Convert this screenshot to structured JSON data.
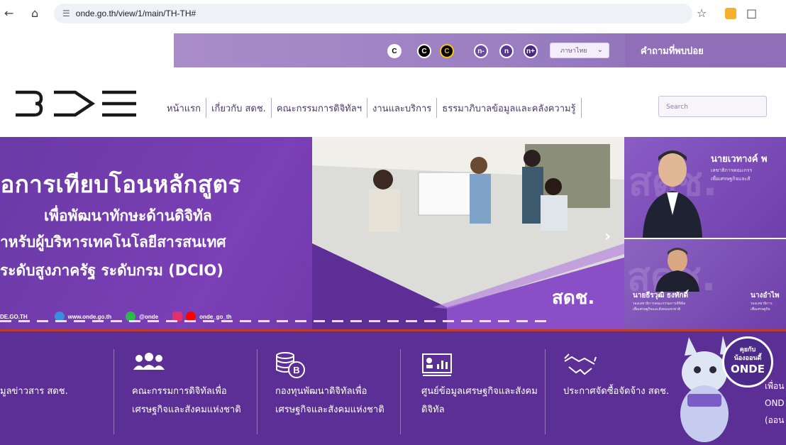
{
  "browser": {
    "url": "onde.go.th/view/1/main/TH-TH#",
    "icons": [
      "back-icon",
      "home-icon",
      "site-info-icon",
      "bookmark-star-icon",
      "extension-icon",
      "extensions-puzzle-icon"
    ]
  },
  "topbar": {
    "font_size_buttons": [
      "C",
      "C",
      "C"
    ],
    "contrast_buttons": [
      "n-",
      "n",
      "n+"
    ],
    "language_selected": "ภาษาไทย",
    "faq_label": "คำถามที่พบบ่อย"
  },
  "nav": {
    "items": [
      "หน้าแรก",
      "เกี่ยวกับ สดช.",
      "คณะกรรมการดิจิทัลฯ",
      "งานและบริการ",
      "ธรรมาภิบาลข้อมูลและคลังความรู้"
    ],
    "search_placeholder": "Search"
  },
  "hero": {
    "line1": "ื่อการเทียบโอนหลักสูตร",
    "line2": "เพื่อพัฒนาทักษะด้านดิจิทัล",
    "line3": "าหรับผู้บริหารเทคโนโลยีสารสนเทศ",
    "line4": "ระดับสูงภาครัฐ ระดับกรม (DCIO)",
    "footer": {
      "domain_partial": "DE.GO.TH",
      "website": "www.onde.go.th",
      "line_id": "@onde",
      "social": "onde_go_th"
    },
    "brand": "สดช.",
    "next_arrow": "›"
  },
  "executives": {
    "top": {
      "name": "นายเวทางค์ พ",
      "role_line1": "เลขาธิการคณะกรร",
      "role_line2": "เพื่อเศรษฐกิจและสั"
    },
    "bottom_left": {
      "name": "นายธีรวุฒิ ธงทักดิ์",
      "role_line1": "รองเลขาธิการคณะกรรมการดิจิทัล",
      "role_line2": "เพื่อเศรษฐกิจและสังคมแห่งชาติ"
    },
    "bottom_right": {
      "name": "นางอำไพ",
      "role_line1": "รองเลขาธิการ",
      "role_line2": "เพื่อเศรษฐกิจ"
    },
    "watermark": "สดช."
  },
  "services": [
    {
      "label": "มูลข่าวสาร สดช.",
      "icon": "info-icon"
    },
    {
      "label": "คณะกรรมการดิจิทัลเพื่อเศรษฐกิจและสังคมแห่งชาติ",
      "icon": "people-group-icon"
    },
    {
      "label": "กองทุนพัฒนาดิจิทัลเพื่อเศรษฐกิจและสังคมแห่งชาติ",
      "icon": "coins-fund-icon"
    },
    {
      "label": "ศูนย์ข้อมูลเศรษฐกิจและสังคมดิจิทัล",
      "icon": "data-chart-icon"
    },
    {
      "label": "ประกาศจัดซื้อจัดจ้าง สดช.",
      "icon": "handshake-icon"
    }
  ],
  "mascot": {
    "badge_line1": "คุยกับ",
    "badge_line2": "น้องออนดี้",
    "badge_name": "ONDE",
    "side_partial_1": "เพื่อน",
    "side_partial_2": "OND",
    "side_partial_3": "(ออน"
  },
  "colors": {
    "brand_purple": "#5b2f96",
    "strip_purple": "#9b7fc2",
    "accent_red": "#c0392b"
  }
}
